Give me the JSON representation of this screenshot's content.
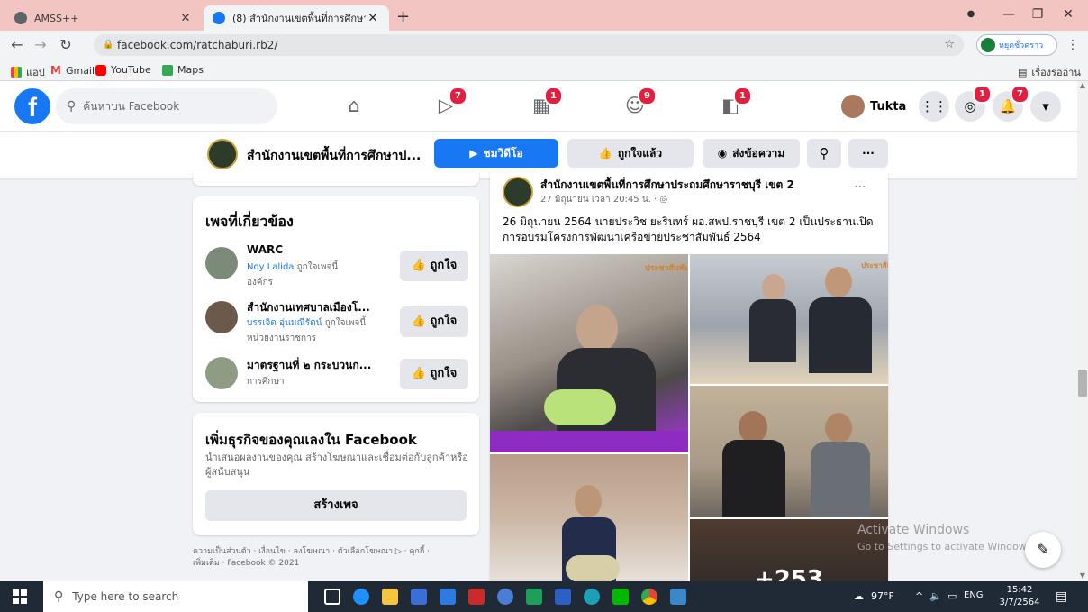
{
  "browser": {
    "tabs": [
      {
        "title": "AMSS++",
        "favicon_color": "#5f6368"
      },
      {
        "title": "(8) สำนักงานเขตพื้นที่การศึกษาประถ",
        "favicon_color": "#1877f2"
      }
    ],
    "new_tab_symbol": "+",
    "url": "facebook.com/ratchaburi.rb2/",
    "profile_label": "หยุดชั่วคราว",
    "bookmarks": [
      {
        "label": "แอป",
        "color": "#e8453c"
      },
      {
        "label": "Gmail",
        "color": "#ea4335"
      },
      {
        "label": "YouTube",
        "color": "#ff0000"
      },
      {
        "label": "Maps",
        "color": "#34a853"
      }
    ],
    "reading_list_label": "เรื่องรออ่าน"
  },
  "fb_header": {
    "search_placeholder": "ค้นหาบน Facebook",
    "nav_badges": {
      "watch": "7",
      "marketplace": "1",
      "groups": "9",
      "gaming": "1"
    },
    "user_name": "Tukta",
    "messenger_badge": "1",
    "notifications_badge": "7"
  },
  "page_bar": {
    "page_name": "สำนักงานเขตพื้นที่การศึกษาป...",
    "watch_video_label": "ชมวิดีโอ",
    "liked_label": "ถูกใจแล้ว",
    "message_label": "ส่งข้อความ",
    "more_label": "···"
  },
  "related_pages": {
    "title": "เพจที่เกี่ยวข้อง",
    "like_label": "ถูกใจ",
    "items": [
      {
        "name": "WARC",
        "friend": "Noy Lalida",
        "friend_suffix": "ถูกใจเพจนี้",
        "category": "องค์กร"
      },
      {
        "name": "สำนักงานเทศบาลเมืองโ...",
        "friend": "บรรเจิด อุ่นมณีรัตน์",
        "friend_suffix": "ถูกใจเพจนี้",
        "category": "หน่วยงานราชการ"
      },
      {
        "name": "มาตรฐานที่ ๒ กระบวนก...",
        "friend": "",
        "friend_suffix": "",
        "category": "การศึกษา"
      }
    ]
  },
  "business_card": {
    "title": "เพิ่มธุรกิจของคุณเลงใน Facebook",
    "description": "นำเสนอผลงานของคุณ สร้างโฆษณาและเชื่อมต่อกับลูกค้าหรือผู้สนับสนุน",
    "button": "สร้างเพจ"
  },
  "footer": {
    "line1": "ความเป็นส่วนตัว · เงื่อนไข · ลงโฆษณา · ตัวเลือกโฆษณา ▷ · คุกกี้ ·",
    "line2": "เพิ่มเติม · Facebook © 2021"
  },
  "post": {
    "author": "สำนักงานเขตพื้นที่การศึกษาประถมศึกษาราชบุรี เขต 2",
    "meta": "27 มิถุนายน เวลา 20:45 น. · ◎",
    "text": "26 มิถุนายน 2564 นายประวิช ยะรินทร์ ผอ.สพป.ราชบุรี เขต 2 เป็นประธานเปิดการอบรมโครงการพัฒนาเครือข่ายประชาสัมพันธ์ 2564",
    "more": "···",
    "photo_overlay_count": "+253",
    "photo_logo": "ประชาสัมพันธ์"
  },
  "activate_windows": {
    "title": "Activate Windows",
    "subtitle": "Go to Settings to activate Windows."
  },
  "taskbar": {
    "search_placeholder": "Type here to search",
    "weather": "97°F",
    "language": "ENG",
    "time": "15:42",
    "date": "3/7/2564"
  },
  "colors": {
    "fb_blue": "#1877f2",
    "chrome_tab_bg": "#f2c4c2",
    "badge_red": "#e41e3f",
    "taskbar": "#1f2a36"
  }
}
